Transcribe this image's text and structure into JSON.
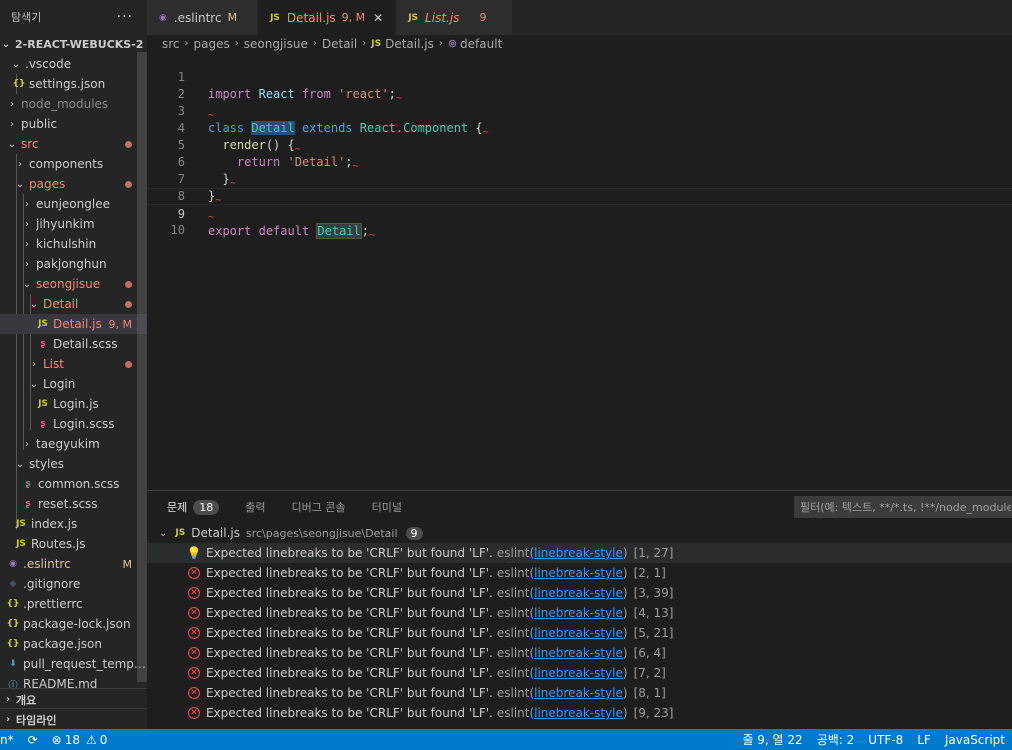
{
  "sidebar": {
    "title": "탐색기",
    "more": "···",
    "root": "2-REACT-WEBUCKS-2",
    "items": [
      {
        "label": ".vscode",
        "kind": "folder-open"
      },
      {
        "label": "settings.json",
        "kind": "json"
      },
      {
        "label": "node_modules",
        "kind": "folder"
      },
      {
        "label": "public",
        "kind": "folder"
      },
      {
        "label": "src",
        "kind": "folder-open"
      },
      {
        "label": "components",
        "kind": "folder"
      },
      {
        "label": "pages",
        "kind": "folder-open"
      },
      {
        "label": "eunjeonglee",
        "kind": "folder"
      },
      {
        "label": "jihyunkim",
        "kind": "folder"
      },
      {
        "label": "kichulshin",
        "kind": "folder"
      },
      {
        "label": "pakjonghun",
        "kind": "folder"
      },
      {
        "label": "seongjisue",
        "kind": "folder-open"
      },
      {
        "label": "Detail",
        "kind": "folder-open"
      },
      {
        "label": "Detail.js",
        "kind": "js",
        "badge": "9, M"
      },
      {
        "label": "Detail.scss",
        "kind": "scss"
      },
      {
        "label": "List",
        "kind": "folder"
      },
      {
        "label": "Login",
        "kind": "folder-open"
      },
      {
        "label": "Login.js",
        "kind": "js"
      },
      {
        "label": "Login.scss",
        "kind": "scss"
      },
      {
        "label": "taegyukim",
        "kind": "folder"
      },
      {
        "label": "styles",
        "kind": "folder-open"
      },
      {
        "label": "common.scss",
        "kind": "scss"
      },
      {
        "label": "reset.scss",
        "kind": "scss"
      },
      {
        "label": "index.js",
        "kind": "js"
      },
      {
        "label": "Routes.js",
        "kind": "js"
      },
      {
        "label": ".eslintrc",
        "kind": "eslint",
        "badge": "M"
      },
      {
        "label": ".gitignore",
        "kind": "git"
      },
      {
        "label": ".prettierrc",
        "kind": "json"
      },
      {
        "label": "package-lock.json",
        "kind": "json"
      },
      {
        "label": "package.json",
        "kind": "json"
      },
      {
        "label": "pull_request_templete.md",
        "kind": "pr"
      },
      {
        "label": "README.md",
        "kind": "info"
      }
    ],
    "sections": [
      "개요",
      "타임라인"
    ]
  },
  "tabs": [
    {
      "icon": "eslint-icon",
      "name": ".eslintrc",
      "status": "M"
    },
    {
      "icon": "js-icon",
      "name": "Detail.js",
      "status": "9, M",
      "close": "✕"
    },
    {
      "icon": "js-icon",
      "name": "List.js",
      "status": "9"
    }
  ],
  "icons": {
    "js": "JS",
    "json": "{}",
    "chevron_right": "›",
    "chevron_down": "⌄"
  },
  "breadcrumb": [
    "src",
    "pages",
    "seongjisue",
    "Detail",
    "Detail.js",
    "default"
  ],
  "editor": {
    "line_numbers": [
      "1",
      "2",
      "3",
      "4",
      "5",
      "6",
      "7",
      "8",
      "9",
      "10"
    ],
    "tokens": {
      "import": "import",
      "React": "React",
      "from": "from",
      "react_str": "'react'",
      "semi": ";",
      "class": "class",
      "Detail": "Detail",
      "extends": "extends",
      "React_Component": "React.",
      "Component": "Component",
      "brace_open": " {",
      "render": "render",
      "render_paren": "() {",
      "return": "return",
      "detail_str": "'Detail'",
      "close_brace": "}",
      "export": "export",
      "default": "default"
    }
  },
  "panel": {
    "tabs": [
      {
        "label": "문제",
        "count": "18"
      },
      {
        "label": "출력"
      },
      {
        "label": "디버그 콘솔"
      },
      {
        "label": "터미널"
      }
    ],
    "filter_placeholder": "필터(예: 텍스트, **/*.ts, !**/node_modules/**)",
    "group": {
      "file": "Detail.js",
      "path": "src\\pages\\seongjisue\\Detail",
      "count": "9"
    },
    "problems": [
      {
        "message": "Expected linebreaks to be 'CRLF' but found 'LF'.",
        "source": "eslint(",
        "rule": "linebreak-style",
        "source_end": ")",
        "pos": "[1, 27]",
        "icon": "lightbulb-icon"
      },
      {
        "message": "Expected linebreaks to be 'CRLF' but found 'LF'.",
        "source": "eslint(",
        "rule": "linebreak-style",
        "source_end": ")",
        "pos": "[2, 1]",
        "icon": "error-icon"
      },
      {
        "message": "Expected linebreaks to be 'CRLF' but found 'LF'.",
        "source": "eslint(",
        "rule": "linebreak-style",
        "source_end": ")",
        "pos": "[3, 39]",
        "icon": "error-icon"
      },
      {
        "message": "Expected linebreaks to be 'CRLF' but found 'LF'.",
        "source": "eslint(",
        "rule": "linebreak-style",
        "source_end": ")",
        "pos": "[4, 13]",
        "icon": "error-icon"
      },
      {
        "message": "Expected linebreaks to be 'CRLF' but found 'LF'.",
        "source": "eslint(",
        "rule": "linebreak-style",
        "source_end": ")",
        "pos": "[5, 21]",
        "icon": "error-icon"
      },
      {
        "message": "Expected linebreaks to be 'CRLF' but found 'LF'.",
        "source": "eslint(",
        "rule": "linebreak-style",
        "source_end": ")",
        "pos": "[6, 4]",
        "icon": "error-icon"
      },
      {
        "message": "Expected linebreaks to be 'CRLF' but found 'LF'.",
        "source": "eslint(",
        "rule": "linebreak-style",
        "source_end": ")",
        "pos": "[7, 2]",
        "icon": "error-icon"
      },
      {
        "message": "Expected linebreaks to be 'CRLF' but found 'LF'.",
        "source": "eslint(",
        "rule": "linebreak-style",
        "source_end": ")",
        "pos": "[8, 1]",
        "icon": "error-icon"
      },
      {
        "message": "Expected linebreaks to be 'CRLF' but found 'LF'.",
        "source": "eslint(",
        "rule": "linebreak-style",
        "source_end": ")",
        "pos": "[9, 23]",
        "icon": "error-icon"
      }
    ]
  },
  "statusbar": {
    "left_clip": "n*",
    "sync": "⟳",
    "errors": "18",
    "warnings": "0",
    "cursor": "줄 9, 열 22",
    "spaces": "공백: 2",
    "encoding": "UTF-8",
    "eol": "LF",
    "language": "JavaScript",
    "accent": "#007acc"
  }
}
